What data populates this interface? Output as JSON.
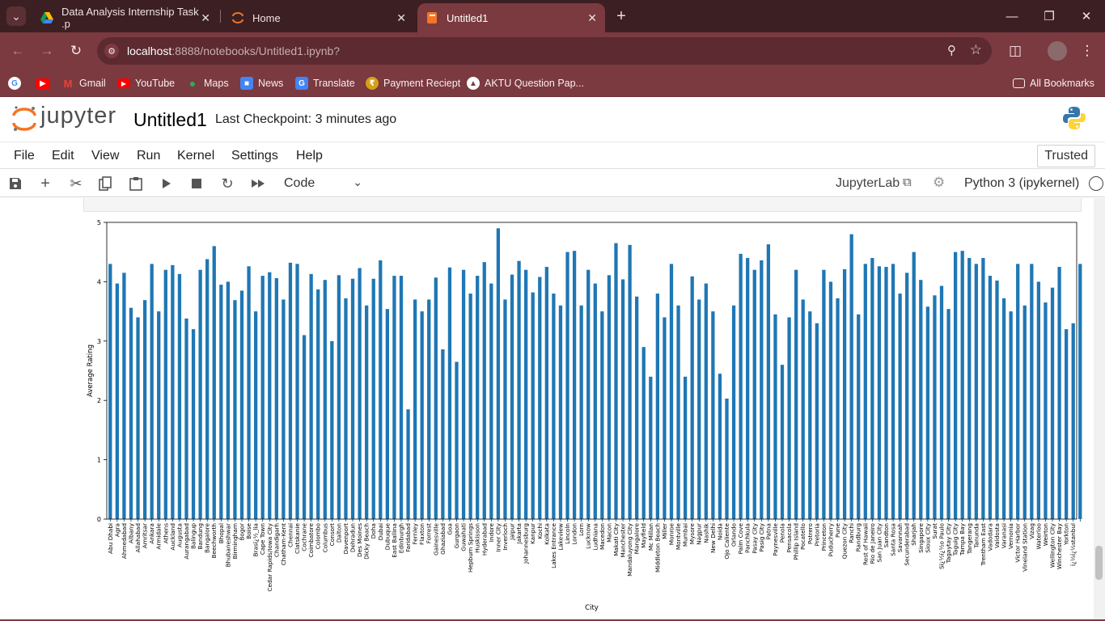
{
  "browser": {
    "tabs": [
      {
        "title": "Data Analysis Internship Task .p",
        "icon": "google-drive-icon"
      },
      {
        "title": "Home",
        "icon": "jupyter-icon"
      },
      {
        "title": "Untitled1",
        "icon": "notebook-icon"
      }
    ],
    "url_host": "localhost",
    "url_path": ":8888/notebooks/Untitled1.ipynb?",
    "bookmarks": [
      {
        "label": "",
        "icon": "google-icon",
        "color": "#ffffff"
      },
      {
        "label": "",
        "icon": "youtube-icon",
        "color": "#ff0000"
      },
      {
        "label": "Gmail",
        "icon": "gmail-icon",
        "color": "#ea4335"
      },
      {
        "label": "YouTube",
        "icon": "youtube-icon",
        "color": "#ff0000"
      },
      {
        "label": "Maps",
        "icon": "maps-icon",
        "color": "#34a853"
      },
      {
        "label": "News",
        "icon": "news-icon",
        "color": "#4285f4"
      },
      {
        "label": "Translate",
        "icon": "translate-icon",
        "color": "#4285f4"
      },
      {
        "label": "Payment Reciept",
        "icon": "payment-icon",
        "color": "#d4a017"
      },
      {
        "label": "AKTU Question Pap...",
        "icon": "aktu-icon",
        "color": "#ffffff"
      }
    ],
    "all_bookmarks": "All Bookmarks"
  },
  "jupyter": {
    "logo_text": "jupyter",
    "notebook_title": "Untitled1",
    "checkpoint": "Last Checkpoint: 3 minutes ago",
    "menu": [
      "File",
      "Edit",
      "View",
      "Run",
      "Kernel",
      "Settings",
      "Help"
    ],
    "trusted": "Trusted",
    "cell_type": "Code",
    "jupyterlab_label": "JupyterLab",
    "kernel_name": "Python 3 (ipykernel)"
  },
  "chart_data": {
    "type": "bar",
    "xlabel": "City",
    "ylabel": "Average Rating",
    "ylim": [
      0,
      5
    ],
    "yticks": [
      0,
      1,
      2,
      3,
      4,
      5
    ],
    "color": "#1f77b4",
    "categories": [
      "Abu Dhabi",
      "Agra",
      "Ahmedabad",
      "Albany",
      "Allahabad",
      "Amritsar",
      "Ankara",
      "Armidale",
      "Athens",
      "Auckland",
      "Augusta",
      "Aurangabad",
      "Balingup",
      "Bandung",
      "Bangalore",
      "Beechworth",
      "Bhopal",
      "Bhubaneshwar",
      "Birmingham",
      "Bogor",
      "Boise",
      "Brasï¿½_lia",
      "Cape Town",
      "Cedar Rapids/Iowa City",
      "Chandigarh",
      "Chatham-Kent",
      "Chennai",
      "Clatskanie",
      "Cochrane",
      "Coimbatore",
      "Colombo",
      "Columbus",
      "Consort",
      "Dalton",
      "Davenport",
      "Dehradun",
      "Des Moines",
      "Dicky Beach",
      "Doha",
      "Dubai",
      "Dubuque",
      "East Ballina",
      "Edinburgh",
      "Faridabad",
      "Fernley",
      "Flaxton",
      "Forrest",
      "Gainesville",
      "Ghaziabad",
      "Goa",
      "Gurgaon",
      "Guwahati",
      "Hepburn Springs",
      "Huskisson",
      "Hyderabad",
      "Indore",
      "Inner City",
      "Inverloch",
      "Jaipur",
      "Jakarta",
      "Johannesburg",
      "Kanpur",
      "Kochi",
      "Kolkata",
      "Lakes Entrance",
      "Lakeview",
      "Lincoln",
      "London",
      "Lorn",
      "Lucknow",
      "Ludhiana",
      "Macedon",
      "Macon",
      "Makati City",
      "Manchester",
      "Mandaluyong City",
      "Mangalore",
      "Mayfield",
      "Mc Millan",
      "Middleton Beach",
      "Miller",
      "Monroe",
      "Montville",
      "Mumbai",
      "Mysore",
      "Nagpur",
      "Nashik",
      "New Delhi",
      "Noida",
      "Ojo Caliente",
      "Orlando",
      "Palm Cove",
      "Panchkula",
      "Pasay City",
      "Pasig City",
      "Patna",
      "Paynesville",
      "Penola",
      "Pensacola",
      "Phillip Island",
      "Pocatello",
      "Potrero",
      "Pretoria",
      "Princeton",
      "Puducherry",
      "Pune",
      "Quezon City",
      "Ranchi",
      "Randburg",
      "Rest of Hawaii",
      "Rio de Janeiro",
      "San Juan City",
      "Sandton",
      "Santa Rosa",
      "Savannah",
      "Secunderabad",
      "Sharjah",
      "Singapore",
      "Sioux City",
      "Surat",
      "Sï¿½ï¿½o Paulo",
      "Tagaytay City",
      "Taguig City",
      "Tampa Bay",
      "Tangerang",
      "Tanunda",
      "Trentham East",
      "Vadodara",
      "Valdosta",
      "Varanasi",
      "Vernonia",
      "Victor Harbor",
      "Vineland Station",
      "Vizag",
      "Waterloo",
      "Weirton",
      "Wellington City",
      "Winchester Bay",
      "Yorkton",
      "ï¿½ï¿½stanbul"
    ],
    "values": [
      4.3,
      3.97,
      4.15,
      3.56,
      3.4,
      3.69,
      4.3,
      3.5,
      4.2,
      4.28,
      4.13,
      3.38,
      3.2,
      4.2,
      4.38,
      4.6,
      3.95,
      4.0,
      3.69,
      3.85,
      4.26,
      3.5,
      4.1,
      4.16,
      4.06,
      3.7,
      4.32,
      4.3,
      3.1,
      4.13,
      3.87,
      4.03,
      3.0,
      4.11,
      3.72,
      4.05,
      4.23,
      3.6,
      4.05,
      4.36,
      3.54,
      4.1,
      4.1,
      1.85,
      3.7,
      3.5,
      3.7,
      4.07,
      2.86,
      4.24,
      2.65,
      4.2,
      3.8,
      4.1,
      4.33,
      3.97,
      4.9,
      3.7,
      4.12,
      4.35,
      4.2,
      3.82,
      4.08,
      4.25,
      3.8,
      3.6,
      4.5,
      4.52,
      3.6,
      4.2,
      3.97,
      3.5,
      4.11,
      4.65,
      4.04,
      4.62,
      3.75,
      2.9,
      2.4,
      3.8,
      3.4,
      4.3,
      3.6,
      2.4,
      4.09,
      3.7,
      3.97,
      3.5,
      2.45,
      2.03,
      3.6,
      4.47,
      4.4,
      4.2,
      4.36,
      4.63,
      3.45,
      2.6,
      3.4,
      4.2,
      3.7,
      3.5,
      3.3,
      4.2,
      4.0,
      3.72,
      4.21,
      4.8,
      3.45,
      4.3,
      4.4,
      4.26,
      4.25,
      4.3,
      3.8,
      4.15,
      4.5,
      4.03,
      3.58,
      3.77,
      3.93,
      3.54,
      4.5,
      4.52,
      4.4,
      4.3,
      4.4,
      4.1,
      4.02,
      3.72,
      3.5,
      4.3,
      3.6,
      4.3,
      4.0,
      3.65,
      3.9,
      4.25,
      3.2,
      3.3,
      4.3
    ]
  }
}
